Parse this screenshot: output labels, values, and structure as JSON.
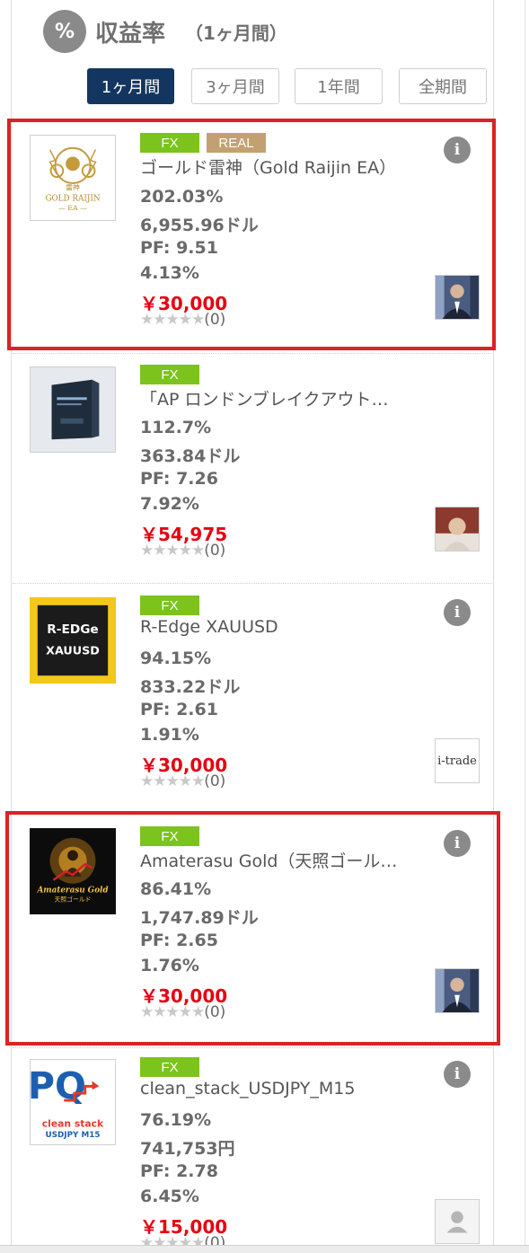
{
  "header": {
    "icon_glyph": "%",
    "title": "収益率",
    "subtitle": "（1ヶ月間）"
  },
  "tabs": [
    {
      "label": "1ヶ月間",
      "active": true
    },
    {
      "label": "3ヶ月間",
      "active": false
    },
    {
      "label": "1年間",
      "active": false
    },
    {
      "label": "全期間",
      "active": false
    }
  ],
  "products": [
    {
      "badges": [
        "FX",
        "REAL"
      ],
      "name": "ゴールド雷神（Gold Raijin EA）",
      "return_pct": "202.03%",
      "profit": "6,955.96ドル",
      "pf": "PF: 9.51",
      "drawdown": "4.13%",
      "price": "￥30,000",
      "stars": "★★★★★",
      "reviews": "(0)",
      "info": "i",
      "thumb_text": [
        "GOLD RAIJIN",
        "— EA —",
        "雷神"
      ],
      "highlighted": true
    },
    {
      "badges": [
        "FX"
      ],
      "name": "「AP ロンドンブレイクアウト…",
      "return_pct": "112.7%",
      "profit": "363.84ドル",
      "pf": "PF: 7.26",
      "drawdown": "7.92%",
      "price": "￥54,975",
      "stars": "★★★★★",
      "reviews": "(0)",
      "info": "",
      "thumb_text": [],
      "highlighted": false
    },
    {
      "badges": [
        "FX"
      ],
      "name": "R-Edge XAUUSD",
      "return_pct": "94.15%",
      "profit": "833.22ドル",
      "pf": "PF: 2.61",
      "drawdown": "1.91%",
      "price": "￥30,000",
      "stars": "★★★★★",
      "reviews": "(0)",
      "info": "i",
      "thumb_text": [
        "R-EDGe",
        "XAUUSD"
      ],
      "avatar_text": "i-trade",
      "highlighted": false
    },
    {
      "badges": [
        "FX"
      ],
      "name": "Amaterasu Gold（天照ゴール…",
      "return_pct": "86.41%",
      "profit": "1,747.89ドル",
      "pf": "PF: 2.65",
      "drawdown": "1.76%",
      "price": "￥30,000",
      "stars": "★★★★★",
      "reviews": "(0)",
      "info": "i",
      "thumb_text": [
        "Amaterasu Gold",
        "天照ゴールド"
      ],
      "highlighted": true
    },
    {
      "badges": [
        "FX"
      ],
      "name": "clean_stack_USDJPY_M15",
      "return_pct": "76.19%",
      "profit": "741,753円",
      "pf": "PF: 2.78",
      "drawdown": "6.45%",
      "price": "￥15,000",
      "stars": "★★★★★",
      "reviews": "(0)",
      "info": "i",
      "thumb_text": [
        "PQ",
        "clean stack",
        "USDJPY M15"
      ],
      "highlighted": false
    }
  ],
  "colors": {
    "accent_tab": "#12365f",
    "fx_badge": "#7cc31e",
    "real_badge": "#c2a071",
    "price": "#e60012",
    "highlight": "#dc2224"
  }
}
